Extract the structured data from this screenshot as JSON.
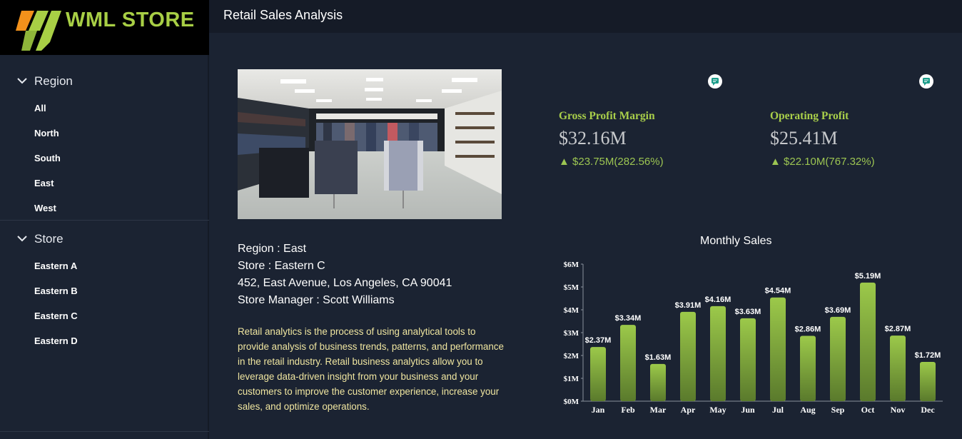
{
  "brand": {
    "name": "WML STORE",
    "accent": "#a8cf45",
    "orange": "#f2911b"
  },
  "header": {
    "title": "Retail Sales Analysis"
  },
  "sidebar": {
    "groups": [
      {
        "label": "Region",
        "expanded": true,
        "items": [
          "All",
          "North",
          "South",
          "East",
          "West"
        ]
      },
      {
        "label": "Store",
        "expanded": true,
        "items": [
          "Eastern A",
          "Eastern B",
          "Eastern C",
          "Eastern D"
        ]
      }
    ]
  },
  "store": {
    "region": "Region : East",
    "name": "Store : Eastern C",
    "address": "452, East Avenue, Los Angeles, CA 90041",
    "manager": "Store Manager : Scott Williams",
    "description": "Retail analytics is the process of using analytical tools to provide analysis of business trends, patterns, and performance in the retail industry. Retail business analytics allow you to leverage data-driven insight from your business and your customers to improve the customer experience, increase your sales, and optimize operations."
  },
  "kpis": [
    {
      "title": "Gross Profit Margin",
      "value": "$32.16M",
      "delta": "$23.75M(282.56%)",
      "icon": "comment-icon"
    },
    {
      "title": "Operating Profit",
      "value": "$25.41M",
      "delta": "$22.10M(767.32%)",
      "icon": "comment-icon"
    }
  ],
  "colors": {
    "bar_top": "#9cc94a",
    "bar_bottom": "#5a7a2c",
    "delta_up": "#9cc552"
  },
  "chart_data": {
    "type": "bar",
    "title": "Monthly Sales",
    "categories": [
      "Jan",
      "Feb",
      "Mar",
      "Apr",
      "May",
      "Jun",
      "Jul",
      "Aug",
      "Sep",
      "Oct",
      "Nov",
      "Dec"
    ],
    "values": [
      2.37,
      3.34,
      1.63,
      3.91,
      4.16,
      3.63,
      4.54,
      2.86,
      3.69,
      5.19,
      2.87,
      1.72
    ],
    "labels": [
      "$2.37M",
      "$3.34M",
      "$1.63M",
      "$3.91M",
      "$4.16M",
      "$3.63M",
      "$4.54M",
      "$2.86M",
      "$3.69M",
      "$5.19M",
      "$2.87M",
      "$1.72M"
    ],
    "yticks": [
      "$0M",
      "$1M",
      "$2M",
      "$3M",
      "$4M",
      "$5M",
      "$6M"
    ],
    "ylim": [
      0,
      6
    ],
    "grid": false,
    "xlabel": "",
    "ylabel": ""
  }
}
